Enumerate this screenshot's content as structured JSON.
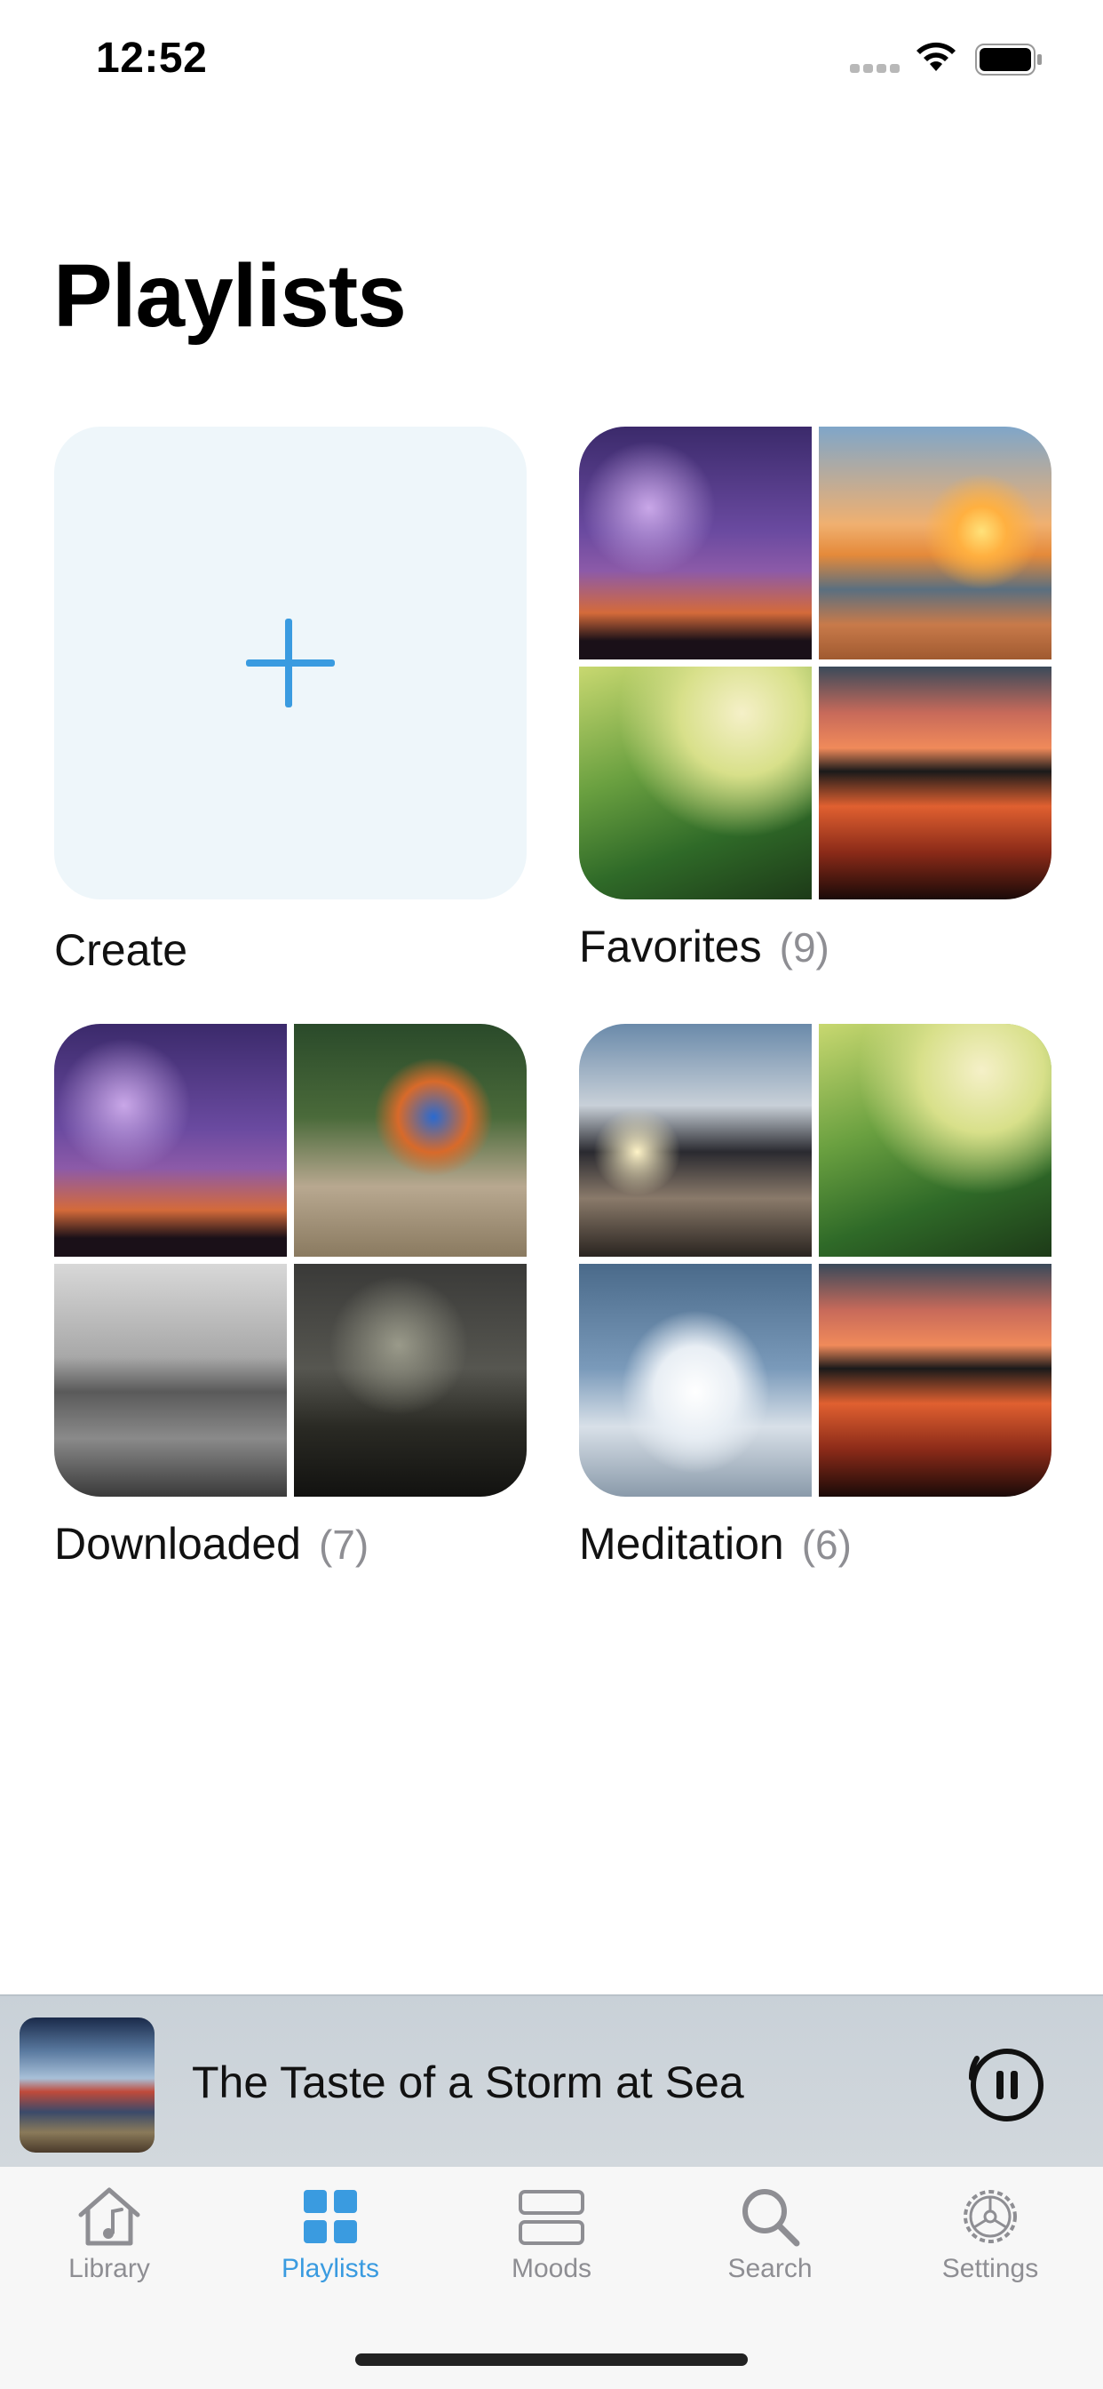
{
  "status_bar": {
    "time": "12:52"
  },
  "page": {
    "title": "Playlists"
  },
  "cards": {
    "create": {
      "label": "Create"
    },
    "favorites": {
      "label": "Favorites",
      "count": "(9)"
    },
    "downloaded": {
      "label": "Downloaded",
      "count": "(7)"
    },
    "meditation": {
      "label": "Meditation",
      "count": "(6)"
    }
  },
  "now_playing": {
    "title": "The Taste of a Storm at Sea"
  },
  "tabs": [
    {
      "label": "Library",
      "icon": "house-music-icon"
    },
    {
      "label": "Playlists",
      "icon": "grid-icon",
      "active": true
    },
    {
      "label": "Moods",
      "icon": "moods-icon"
    },
    {
      "label": "Search",
      "icon": "search-icon"
    },
    {
      "label": "Settings",
      "icon": "gear-icon"
    }
  ],
  "colors": {
    "accent": "#3a9be0",
    "create_background": "#eef6fa",
    "inactive": "#8e8e93"
  }
}
